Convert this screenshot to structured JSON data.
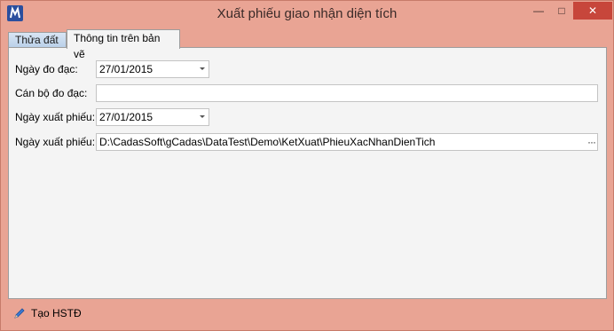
{
  "window": {
    "title": "Xuất phiếu giao nhận diện tích",
    "minimize_glyph": "—",
    "maximize_glyph": "□",
    "close_glyph": "✕"
  },
  "tabs": [
    {
      "label": "Thửa đất",
      "active": false
    },
    {
      "label": "Thông tin trên bản vẽ",
      "active": true
    }
  ],
  "form": {
    "survey_date": {
      "label": "Ngày đo đạc:",
      "value": "27/01/2015"
    },
    "surveyor": {
      "label": "Cán bộ đo đạc:",
      "value": ""
    },
    "export_date": {
      "label": "Ngày xuất phiếu:",
      "value": "27/01/2015"
    },
    "export_path": {
      "label": "Ngày xuất phiếu:",
      "value": "D:\\CadasSoft\\gCadas\\DataTest\\Demo\\KetXuat\\PhieuXacNhanDienTich",
      "browse": "···"
    }
  },
  "footer": {
    "create_label": "Tạo HSTĐ",
    "icon": "pencil-icon"
  },
  "colors": {
    "frame": "#e9a494",
    "close_button": "#c7463b",
    "tab_inactive": "#c5d8ee",
    "panel": "#f4f4f4"
  }
}
